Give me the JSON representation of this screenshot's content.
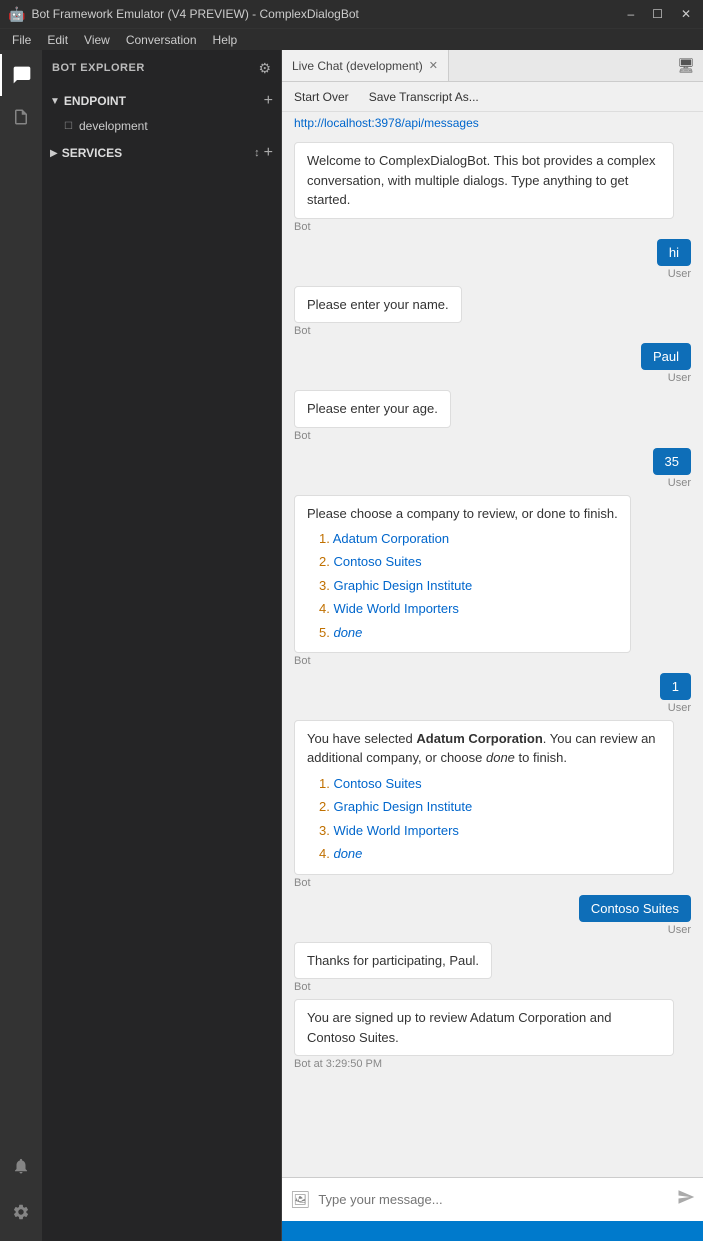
{
  "titleBar": {
    "icon": "🤖",
    "text": "Bot Framework Emulator (V4 PREVIEW) - ComplexDialogBot",
    "minimize": "–",
    "maximize": "☐",
    "close": "✕"
  },
  "menuBar": {
    "items": [
      "File",
      "Edit",
      "View",
      "Conversation",
      "Help"
    ]
  },
  "sidebar": {
    "title": "BOT EXPLORER",
    "gearIcon": "⚙",
    "endpoint": {
      "label": "ENDPOINT",
      "addIcon": "+",
      "children": [
        {
          "label": "development"
        }
      ]
    },
    "services": {
      "label": "SERVICES",
      "sortIcon": "↕",
      "addIcon": "+"
    }
  },
  "leftIcons": {
    "chat": "💬",
    "doc": "📄",
    "bellBottom": "🔔",
    "gearBottom": "⚙"
  },
  "chat": {
    "tab": {
      "label": "Live Chat (development)",
      "closeIcon": "✕",
      "monitorIcon": "🖥"
    },
    "toolbar": {
      "startOver": "Start Over",
      "saveTranscript": "Save Transcript As..."
    },
    "url": "http://localhost:3978/api/messages",
    "messages": [
      {
        "type": "bot",
        "text": "Welcome to ComplexDialogBot. This bot provides a complex conversation, with multiple dialogs. Type anything to get started.",
        "label": "Bot"
      },
      {
        "type": "user",
        "bubble": "hi",
        "label": "User"
      },
      {
        "type": "bot",
        "text": "Please enter your name.",
        "label": "Bot"
      },
      {
        "type": "user",
        "bubble": "Paul",
        "label": "User"
      },
      {
        "type": "bot",
        "text": "Please enter your age.",
        "label": "Bot"
      },
      {
        "type": "user",
        "bubble": "35",
        "label": "User"
      },
      {
        "type": "bot-list",
        "intro": "Please choose a company to review, or done to finish.",
        "items": [
          {
            "num": "1.",
            "name": "Adatum Corporation"
          },
          {
            "num": "2.",
            "name": "Contoso Suites"
          },
          {
            "num": "3.",
            "name": "Graphic Design Institute"
          },
          {
            "num": "4.",
            "name": "Wide World Importers"
          },
          {
            "num": "5.",
            "name": "done",
            "isDone": true
          }
        ],
        "label": "Bot"
      },
      {
        "type": "user",
        "bubble": "1",
        "label": "User"
      },
      {
        "type": "bot-rich",
        "prefix": "You have selected ",
        "bold": "Adatum Corporation",
        "suffix": ". You can review an additional company, or choose ",
        "italic": "done",
        "suffix2": " to finish.",
        "items": [
          {
            "num": "1.",
            "name": "Contoso Suites"
          },
          {
            "num": "2.",
            "name": "Graphic Design Institute"
          },
          {
            "num": "3.",
            "name": "Wide World Importers"
          },
          {
            "num": "4.",
            "name": "done",
            "isDone": true
          }
        ],
        "label": "Bot"
      },
      {
        "type": "user",
        "bubble": "Contoso Suites",
        "label": "User"
      },
      {
        "type": "bot",
        "text": "Thanks for participating, Paul.",
        "label": "Bot"
      },
      {
        "type": "bot-time",
        "text": "You are signed up to review Adatum Corporation and Contoso Suites.",
        "label": "Bot",
        "time": "Bot at 3:29:50 PM"
      }
    ],
    "input": {
      "placeholder": "Type your message...",
      "imageIcon": "🖼",
      "sendIcon": "➤"
    }
  }
}
